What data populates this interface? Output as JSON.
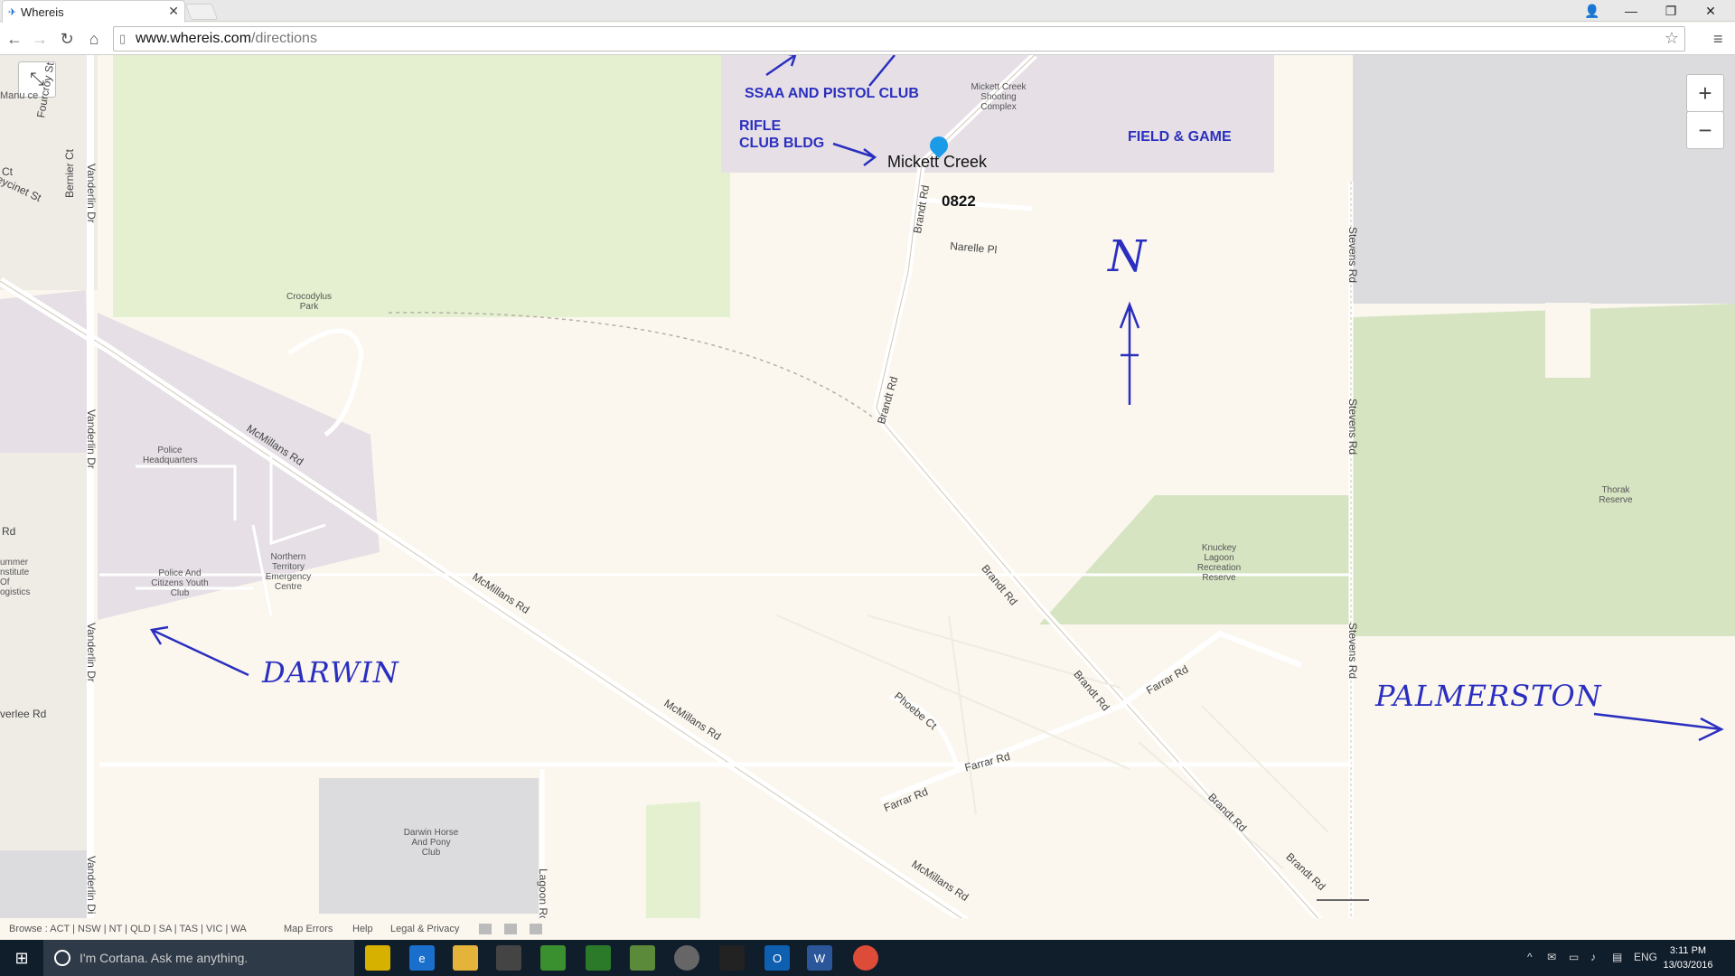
{
  "browser": {
    "tab_title": "Whereis",
    "url_host": "www.whereis.com",
    "url_path": "/directions"
  },
  "map": {
    "pin_label": "Mickett Creek",
    "postcode": "0822",
    "poi": {
      "shooting_complex": "Mickett Creek Shooting Complex",
      "crocodylus_park": "Crocodylus Park",
      "police_hq": "Police Headquarters",
      "police_citizens": "Police And Citizens Youth Club",
      "nt_emergency": "Northern Territory Emergency Centre",
      "knuckey": "Knuckey Lagoon Recreation Reserve",
      "thorak": "Thorak Reserve",
      "horse_club": "Darwin Horse And Pony Club",
      "summer_institute": "ummer nstitute Of ogistics",
      "manunda": "Manu ce"
    },
    "roads": {
      "vanderlin1": "Vanderlin Dr",
      "vanderlin2": "Vanderlin Dr",
      "vanderlin3": "Vanderlin Dr",
      "vanderlin4": "Vanderlin Di",
      "mcmillans1": "McMillans Rd",
      "mcmillans2": "McMillans Rd",
      "mcmillans3": "McMillans Rd",
      "mcmillans4": "McMillans Rd",
      "brandt1": "Brandt Rd",
      "brandt2": "Brandt Rd",
      "brandt3": "Brandt Rd",
      "brandt4": "Brandt Rd",
      "brandt5": "Brandt Rd",
      "brandt6": "Brandt Rd",
      "narelle": "Narelle Pl",
      "stevens1": "Stevens Rd",
      "stevens2": "Stevens Rd",
      "stevens3": "Stevens Rd",
      "farrar1": "Farrar Rd",
      "farrar2": "Farrar Rd",
      "farrar3": "Farrar Rd",
      "phoebe": "Phoebe Ct",
      "lagoon": "Lagoon Rc",
      "fourcroy": "Fourcroy St",
      "bernier": "Bernier Ct",
      "jeycinet": "eycinet St",
      "rd_left": "Rd",
      "verlee": "verlee Rd",
      "ct_left": "Ct"
    },
    "annotations": {
      "ssaa": "SSAA AND PISTOL CLUB",
      "rifle_line1": "RIFLE",
      "rifle_line2": "CLUB BLDG",
      "field_game": "FIELD & GAME",
      "north": "N",
      "darwin": "DARWIN",
      "palmerston": "PALMERSTON"
    },
    "controls": {
      "zoom_in": "+",
      "zoom_out": "−"
    }
  },
  "footer": {
    "browse": "Browse : ACT | NSW | NT | QLD | SA | TAS | VIC | WA",
    "map_errors": "Map Errors",
    "help": "Help",
    "legal": "Legal & Privacy"
  },
  "taskbar": {
    "cortana_placeholder": "I'm Cortana. Ask me anything.",
    "lang": "ENG",
    "time": "3:11 PM",
    "date": "13/03/2016"
  }
}
